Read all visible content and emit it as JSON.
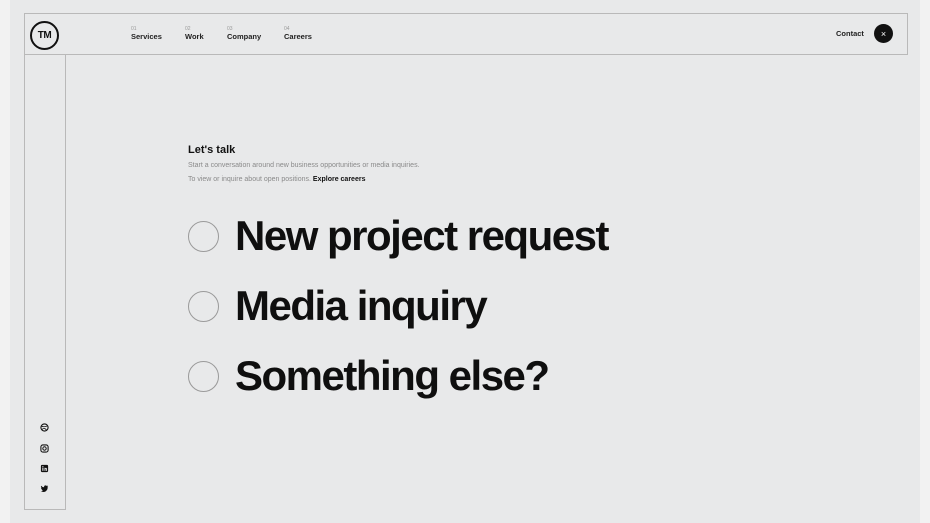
{
  "header": {
    "logo_text": "TM",
    "nav": [
      {
        "num": "01",
        "label": "Services"
      },
      {
        "num": "02",
        "label": "Work"
      },
      {
        "num": "03",
        "label": "Company"
      },
      {
        "num": "04",
        "label": "Careers"
      }
    ],
    "contact_label": "Contact",
    "close_glyph": "×"
  },
  "intro": {
    "title": "Let's talk",
    "line1": "Start a conversation around new business opportunities or media inquiries.",
    "line2_prefix": "To view or inquire about open positions.",
    "line2_link": "Explore careers"
  },
  "options": [
    {
      "label": "New project request"
    },
    {
      "label": "Media inquiry"
    },
    {
      "label": "Something else?"
    }
  ],
  "social": [
    {
      "icon": "dribbble-icon"
    },
    {
      "icon": "instagram-icon"
    },
    {
      "icon": "linkedin-icon"
    },
    {
      "icon": "twitter-icon"
    }
  ],
  "colors": {
    "background": "#e8e9ea",
    "text": "#111111",
    "border": "#b9b9b9",
    "muted": "#8a8a8a"
  }
}
